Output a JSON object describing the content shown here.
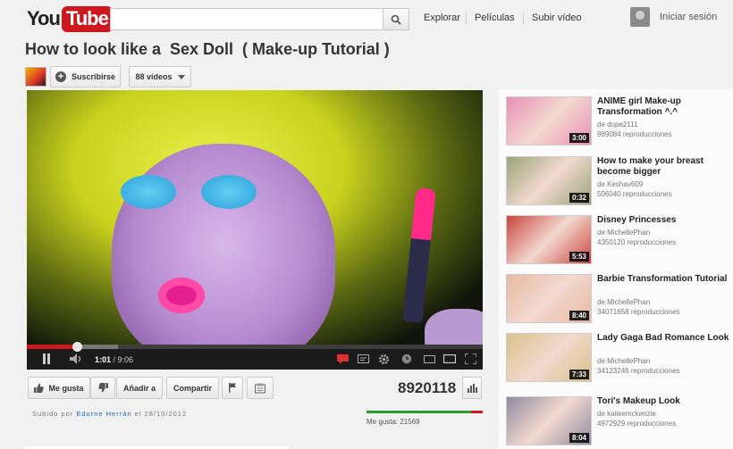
{
  "masthead": {
    "logo_you": "You",
    "logo_tube": "Tube",
    "search_placeholder": "",
    "nav": [
      "Explorar",
      "Películas",
      "Subir vídeo"
    ],
    "signin": "Iniciar sesión"
  },
  "video": {
    "title": "How to look like a  Sex Doll  ( Make-up Tutorial )",
    "subscribe_label": "Suscribirse",
    "videos_label": "88 vídeos",
    "player": {
      "current_time": "1:01",
      "duration": "9:06",
      "played_fraction": 0.11,
      "loaded_fraction": 0.2
    },
    "actions": {
      "like": "Me gusta",
      "add_to": "Añadir a",
      "share": "Compartir"
    },
    "view_count": "8920118",
    "uploaded_prefix": "Subido por",
    "uploader": "Edurne Herrán",
    "uploaded_suffix": "el 28/10/2012",
    "likes_label": "Me gusta: 21569",
    "like_fraction": 0.9
  },
  "sidebar": {
    "items": [
      {
        "title": "ANIME girl Make-up Transformation ^.^",
        "author": "de dope2111",
        "views": "989084 reproducciones",
        "duration": "3:00",
        "thumb_color": "#e98fb7"
      },
      {
        "title": "How to make your breast become bigger",
        "author": "de Keshav609",
        "views": "506040 reproducciones",
        "duration": "0:32",
        "thumb_color": "#9aa37a"
      },
      {
        "title": "Disney Princesses",
        "author": "de MichellePhan",
        "views": "4350120 reproducciones",
        "duration": "5:53",
        "thumb_color": "#c8453f"
      },
      {
        "title": "Barbie Transformation Tutorial",
        "author": "de MichellePhan",
        "views": "34071658 reproducciones",
        "duration": "8:40",
        "thumb_color": "#e6b9a3"
      },
      {
        "title": "Lady Gaga Bad Romance Look",
        "author": "de MichellePhan",
        "views": "34123246 reproducciones",
        "duration": "7:33",
        "thumb_color": "#d8c28a"
      },
      {
        "title": "Tori's Makeup Look",
        "author": "de kaileemckenzie",
        "views": "4972929 reproducciones",
        "duration": "8:04",
        "thumb_color": "#8f8aa0"
      }
    ]
  }
}
